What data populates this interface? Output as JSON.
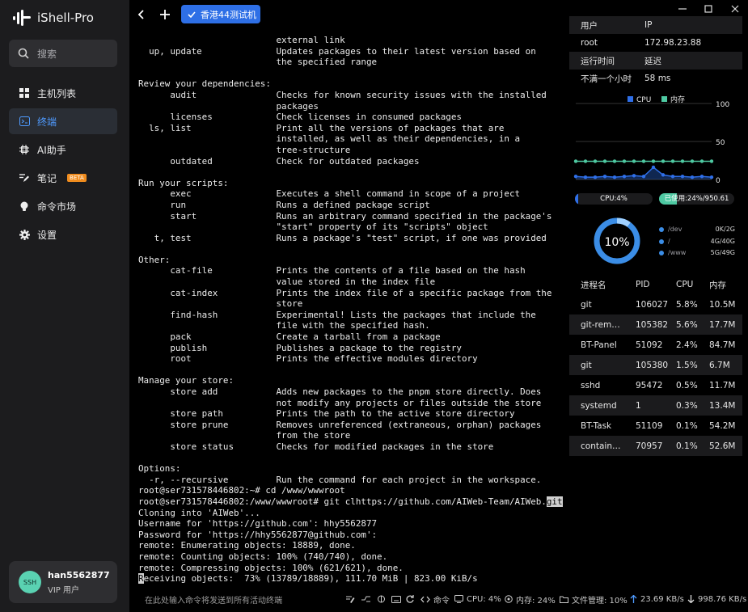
{
  "app": {
    "title": "iShell-Pro"
  },
  "sidebar": {
    "search_placeholder": "搜索",
    "items": [
      {
        "label": "主机列表",
        "icon": "grid-icon"
      },
      {
        "label": "终端",
        "icon": "terminal-icon",
        "active": true
      },
      {
        "label": "AI助手",
        "icon": "ai-icon"
      },
      {
        "label": "笔记",
        "icon": "note-icon",
        "badge": "BETA"
      },
      {
        "label": "命令市场",
        "icon": "bulb-icon"
      },
      {
        "label": "设置",
        "icon": "gear-icon"
      }
    ],
    "user": {
      "avatar": "SSH",
      "name": "han5562877",
      "role": "VIP 用户"
    }
  },
  "tabs": {
    "active_tab": "香港44测试机"
  },
  "terminal": {
    "lines": [
      "                          external link",
      "  up, update              Updates packages to their latest version based on",
      "                          the specified range",
      "",
      "Review your dependencies:",
      "      audit               Checks for known security issues with the installed",
      "                          packages",
      "      licenses            Check licenses in consumed packages",
      "  ls, list                Print all the versions of packages that are",
      "                          installed, as well as their dependencies, in a",
      "                          tree-structure",
      "      outdated            Check for outdated packages",
      "",
      "Run your scripts:",
      "      exec                Executes a shell command in scope of a project",
      "      run                 Runs a defined package script",
      "      start               Runs an arbitrary command specified in the package's",
      "                          \"start\" property of its \"scripts\" object",
      "   t, test                Runs a package's \"test\" script, if one was provided",
      "",
      "Other:",
      "      cat-file            Prints the contents of a file based on the hash",
      "                          value stored in the index file",
      "      cat-index           Prints the index file of a specific package from the",
      "                          store",
      "      find-hash           Experimental! Lists the packages that include the",
      "                          file with the specified hash.",
      "      pack                Create a tarball from a package",
      "      publish             Publishes a package to the registry",
      "      root                Prints the effective modules directory",
      "",
      "Manage your store:",
      "      store add           Adds new packages to the pnpm store directly. Does",
      "                          not modify any projects or files outside the store",
      "      store path          Prints the path to the active store directory",
      "      store prune         Removes unreferenced (extraneous, orphan) packages",
      "                          from the store",
      "      store status        Checks for modified packages in the store",
      "",
      "Options:",
      "  -r, --recursive         Run the command for each project in the workspace.",
      "root@ser731578446802:~# cd /www/wwwroot",
      "root@ser731578446802:/www/wwwroot# git clhttps://github.com/AIWeb-Team/AIWeb.git",
      "Cloning into 'AIWeb'...",
      "Username for 'https://github.com': hhy5562877",
      "Password for 'https://hhy5562877@github.com':",
      "remote: Enumerating objects: 18889, done.",
      "remote: Counting objects: 100% (740/740), done.",
      "remote: Compressing objects: 100% (621/621), done.",
      "Receiving objects:  73% (13789/18889), 111.70 MiB | 823.00 KiB/s"
    ],
    "prompt_highlight": ".gi"
  },
  "bottom": {
    "hint": "在此处输入命令将发送到所有活动终端",
    "cmd_label": "命令",
    "cpu": "CPU: 4%",
    "mem": "内存: 24%",
    "file_mgr": "文件管理: 10%",
    "upload": "23.69 KB/s",
    "download": "998.76 KB/s"
  },
  "panel": {
    "info": [
      [
        "用户",
        "IP"
      ],
      [
        "root",
        "172.98.23.88"
      ],
      [
        "运行时间",
        "延迟"
      ],
      [
        "不满一个小时",
        "58 ms"
      ]
    ],
    "legend": {
      "cpu": "CPU",
      "mem": "内存"
    },
    "cpu_bar": "CPU:4%",
    "cpu_pct": 4,
    "mem_bar": "已使用:24%/950.61 MB",
    "mem_pct": 24,
    "colors": {
      "cpu": "#2f6fe8",
      "mem": "#4ec9a2",
      "ring": "#3b8de6"
    },
    "usage_pct": "10%",
    "usage_value": 10,
    "disks": [
      {
        "name": "/dev",
        "value": "0K/2G"
      },
      {
        "name": "/",
        "value": "4G/40G"
      },
      {
        "name": "/www",
        "value": "5G/49G"
      }
    ],
    "proc_headers": [
      "进程名",
      "PID",
      "CPU",
      "内存"
    ],
    "procs": [
      [
        "git",
        "106027",
        "5.8%",
        "10.5M"
      ],
      [
        "git-remote-...",
        "105382",
        "5.6%",
        "17.7M"
      ],
      [
        "BT-Panel",
        "51092",
        "2.4%",
        "84.7M"
      ],
      [
        "git",
        "105380",
        "1.5%",
        "6.7M"
      ],
      [
        "sshd",
        "95472",
        "0.5%",
        "11.7M"
      ],
      [
        "systemd",
        "1",
        "0.3%",
        "13.4M"
      ],
      [
        "BT-Task",
        "51109",
        "0.1%",
        "54.2M"
      ],
      [
        "containerd",
        "70957",
        "0.1%",
        "52.6M"
      ]
    ]
  },
  "chart_data": {
    "type": "line",
    "ylim": [
      0,
      100
    ],
    "yticks": [
      "100",
      "50",
      "0"
    ],
    "series": [
      {
        "name": "CPU",
        "values": [
          4,
          3,
          3,
          4,
          3,
          4,
          5,
          4,
          16,
          6,
          4,
          4,
          3,
          4,
          3
        ]
      },
      {
        "name": "内存",
        "values": [
          24,
          24,
          24,
          24,
          24,
          24,
          24,
          24,
          24,
          24,
          24,
          24,
          24,
          24,
          24
        ]
      }
    ]
  }
}
